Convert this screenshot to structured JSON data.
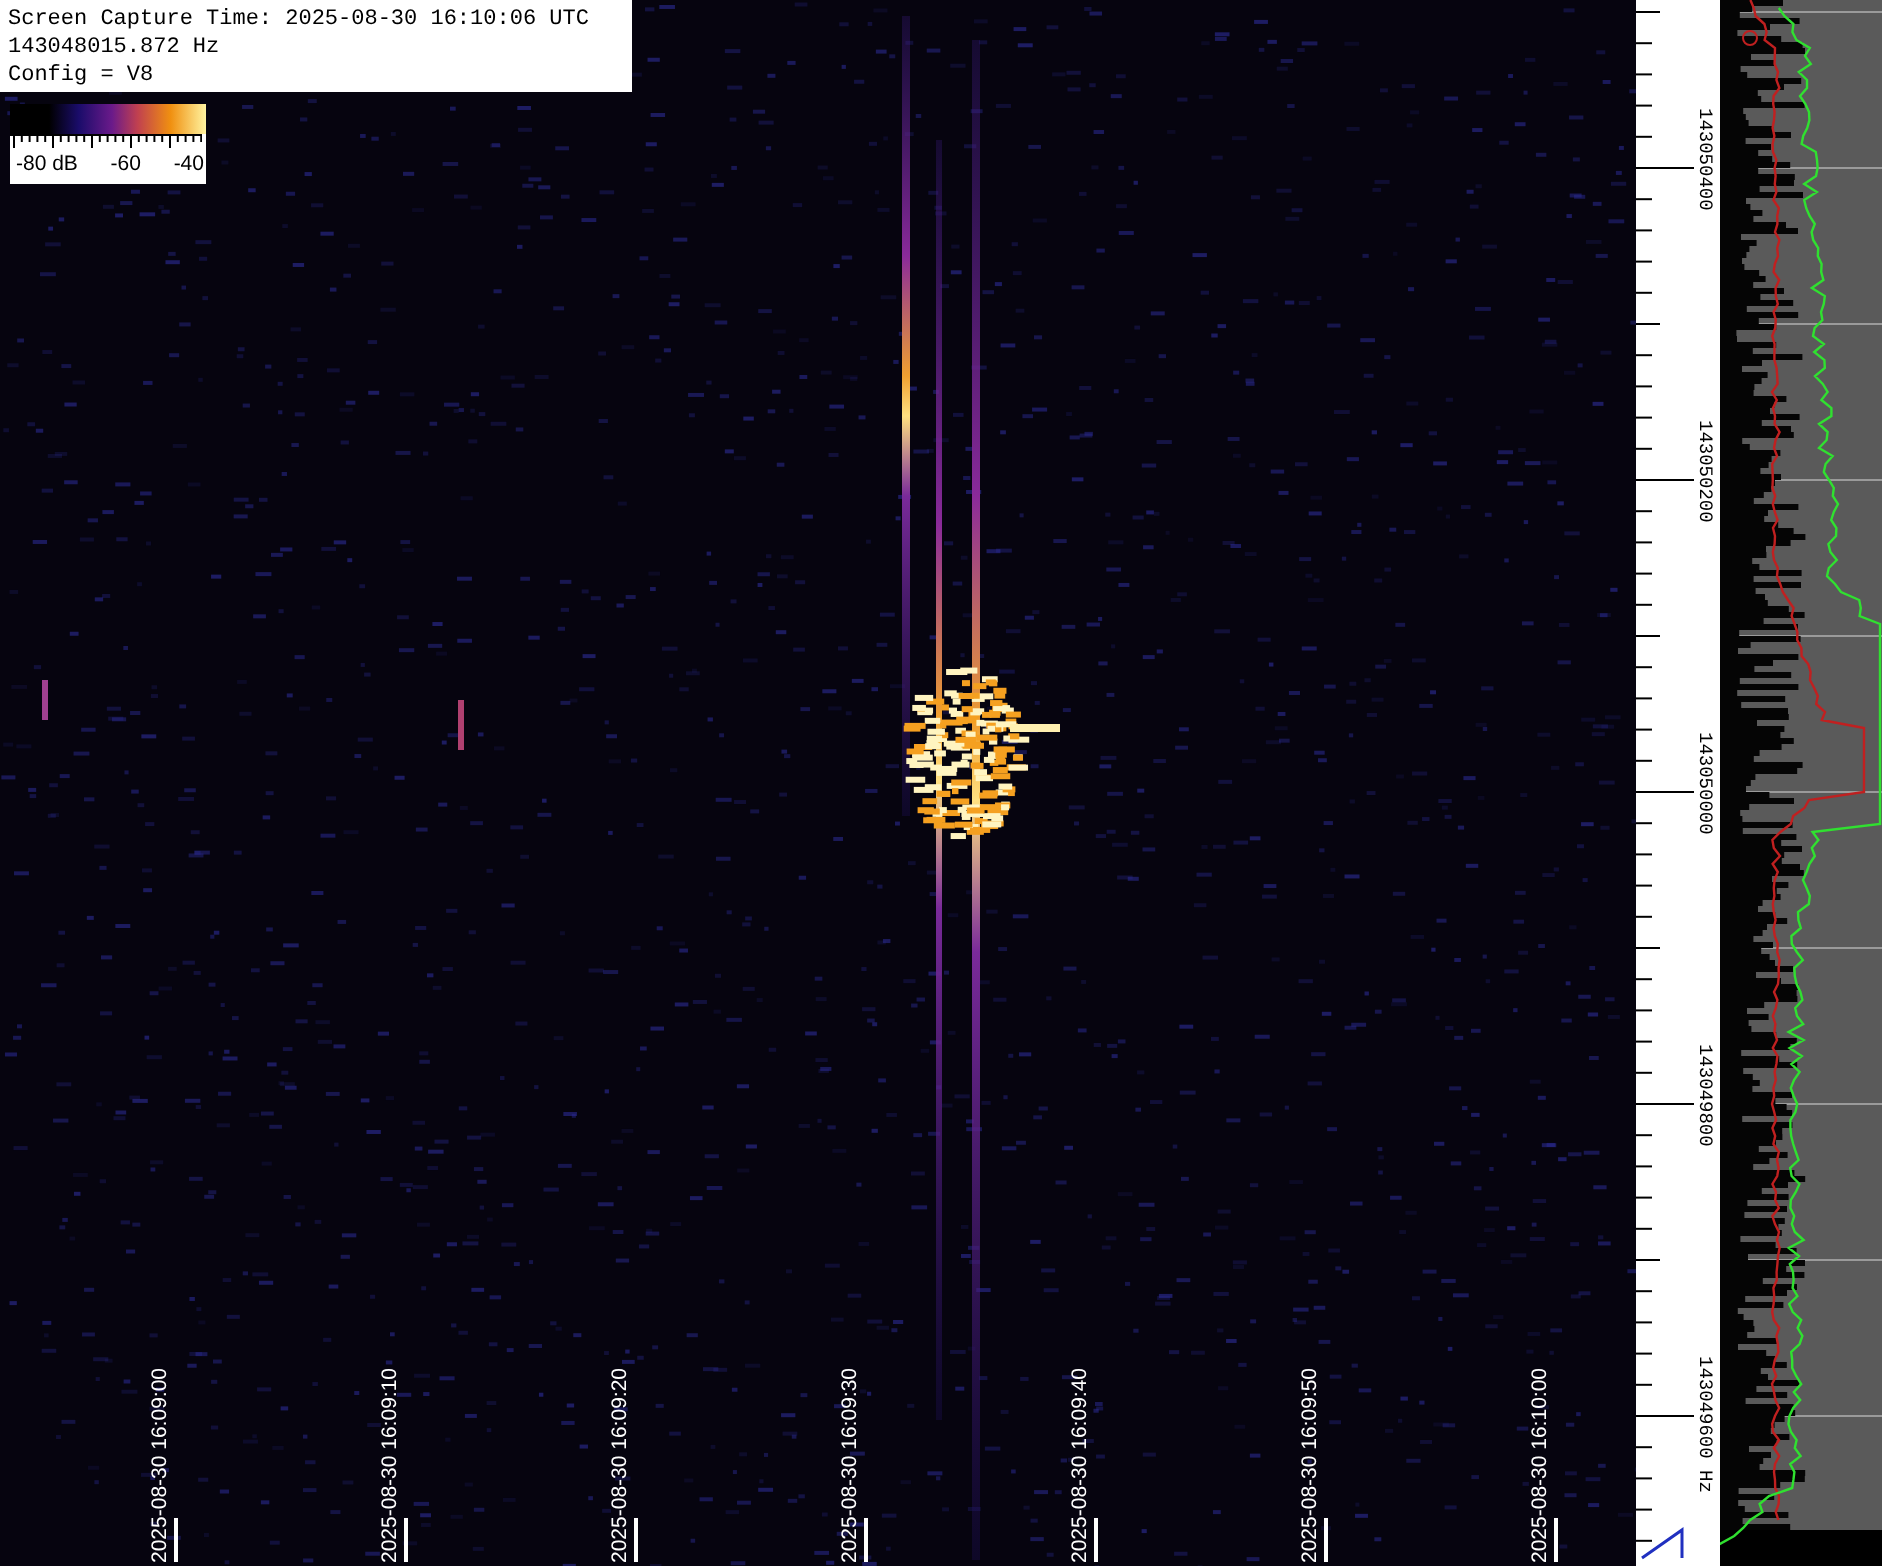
{
  "header": {
    "capture_time": "Screen Capture Time: 2025-08-30 16:10:06 UTC",
    "frequency": "143048015.872 Hz",
    "config": "Config = V8"
  },
  "colorbar": {
    "labels": [
      "-80 dB",
      "-60",
      "-40"
    ]
  },
  "time_axis": {
    "labels": [
      "2025-08-30 16:09:00",
      "2025-08-30 16:09:10",
      "2025-08-30 16:09:20",
      "2025-08-30 16:09:30",
      "2025-08-30 16:09:40",
      "2025-08-30 16:09:50",
      "2025-08-30 16:10:00"
    ]
  },
  "frequency_axis": {
    "labels": [
      "143050400",
      "143050200",
      "143050000",
      "143049800",
      "143049600 Hz"
    ]
  }
}
